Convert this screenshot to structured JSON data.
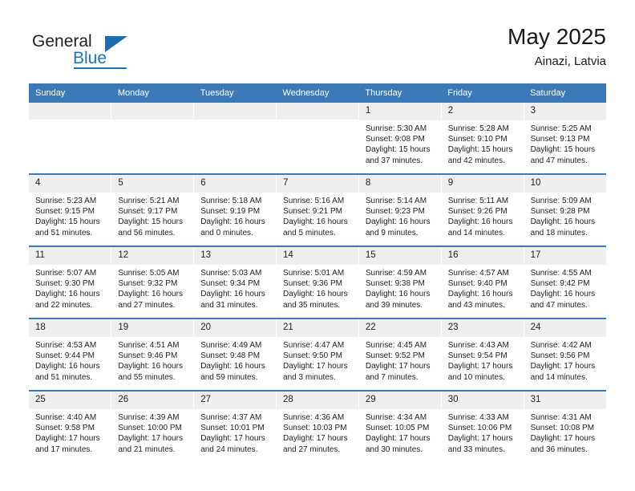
{
  "brand": {
    "name_top": "General",
    "name_bottom": "Blue",
    "triangle_icon": "triangle-icon",
    "color_blue": "#1c75bc",
    "color_dark": "#231f20"
  },
  "header": {
    "title": "May 2025",
    "subtitle": "Ainazi, Latvia"
  },
  "calendar": {
    "accent_color": "#3b79b8",
    "daynum_background": "#efefef",
    "weekday_headers": [
      "Sunday",
      "Monday",
      "Tuesday",
      "Wednesday",
      "Thursday",
      "Friday",
      "Saturday"
    ],
    "weeks": [
      [
        {
          "day": "",
          "sunrise": "",
          "sunset": "",
          "daylight_line1": "",
          "daylight_line2": ""
        },
        {
          "day": "",
          "sunrise": "",
          "sunset": "",
          "daylight_line1": "",
          "daylight_line2": ""
        },
        {
          "day": "",
          "sunrise": "",
          "sunset": "",
          "daylight_line1": "",
          "daylight_line2": ""
        },
        {
          "day": "",
          "sunrise": "",
          "sunset": "",
          "daylight_line1": "",
          "daylight_line2": ""
        },
        {
          "day": "1",
          "sunrise": "Sunrise: 5:30 AM",
          "sunset": "Sunset: 9:08 PM",
          "daylight_line1": "Daylight: 15 hours",
          "daylight_line2": "and 37 minutes."
        },
        {
          "day": "2",
          "sunrise": "Sunrise: 5:28 AM",
          "sunset": "Sunset: 9:10 PM",
          "daylight_line1": "Daylight: 15 hours",
          "daylight_line2": "and 42 minutes."
        },
        {
          "day": "3",
          "sunrise": "Sunrise: 5:25 AM",
          "sunset": "Sunset: 9:13 PM",
          "daylight_line1": "Daylight: 15 hours",
          "daylight_line2": "and 47 minutes."
        }
      ],
      [
        {
          "day": "4",
          "sunrise": "Sunrise: 5:23 AM",
          "sunset": "Sunset: 9:15 PM",
          "daylight_line1": "Daylight: 15 hours",
          "daylight_line2": "and 51 minutes."
        },
        {
          "day": "5",
          "sunrise": "Sunrise: 5:21 AM",
          "sunset": "Sunset: 9:17 PM",
          "daylight_line1": "Daylight: 15 hours",
          "daylight_line2": "and 56 minutes."
        },
        {
          "day": "6",
          "sunrise": "Sunrise: 5:18 AM",
          "sunset": "Sunset: 9:19 PM",
          "daylight_line1": "Daylight: 16 hours",
          "daylight_line2": "and 0 minutes."
        },
        {
          "day": "7",
          "sunrise": "Sunrise: 5:16 AM",
          "sunset": "Sunset: 9:21 PM",
          "daylight_line1": "Daylight: 16 hours",
          "daylight_line2": "and 5 minutes."
        },
        {
          "day": "8",
          "sunrise": "Sunrise: 5:14 AM",
          "sunset": "Sunset: 9:23 PM",
          "daylight_line1": "Daylight: 16 hours",
          "daylight_line2": "and 9 minutes."
        },
        {
          "day": "9",
          "sunrise": "Sunrise: 5:11 AM",
          "sunset": "Sunset: 9:26 PM",
          "daylight_line1": "Daylight: 16 hours",
          "daylight_line2": "and 14 minutes."
        },
        {
          "day": "10",
          "sunrise": "Sunrise: 5:09 AM",
          "sunset": "Sunset: 9:28 PM",
          "daylight_line1": "Daylight: 16 hours",
          "daylight_line2": "and 18 minutes."
        }
      ],
      [
        {
          "day": "11",
          "sunrise": "Sunrise: 5:07 AM",
          "sunset": "Sunset: 9:30 PM",
          "daylight_line1": "Daylight: 16 hours",
          "daylight_line2": "and 22 minutes."
        },
        {
          "day": "12",
          "sunrise": "Sunrise: 5:05 AM",
          "sunset": "Sunset: 9:32 PM",
          "daylight_line1": "Daylight: 16 hours",
          "daylight_line2": "and 27 minutes."
        },
        {
          "day": "13",
          "sunrise": "Sunrise: 5:03 AM",
          "sunset": "Sunset: 9:34 PM",
          "daylight_line1": "Daylight: 16 hours",
          "daylight_line2": "and 31 minutes."
        },
        {
          "day": "14",
          "sunrise": "Sunrise: 5:01 AM",
          "sunset": "Sunset: 9:36 PM",
          "daylight_line1": "Daylight: 16 hours",
          "daylight_line2": "and 35 minutes."
        },
        {
          "day": "15",
          "sunrise": "Sunrise: 4:59 AM",
          "sunset": "Sunset: 9:38 PM",
          "daylight_line1": "Daylight: 16 hours",
          "daylight_line2": "and 39 minutes."
        },
        {
          "day": "16",
          "sunrise": "Sunrise: 4:57 AM",
          "sunset": "Sunset: 9:40 PM",
          "daylight_line1": "Daylight: 16 hours",
          "daylight_line2": "and 43 minutes."
        },
        {
          "day": "17",
          "sunrise": "Sunrise: 4:55 AM",
          "sunset": "Sunset: 9:42 PM",
          "daylight_line1": "Daylight: 16 hours",
          "daylight_line2": "and 47 minutes."
        }
      ],
      [
        {
          "day": "18",
          "sunrise": "Sunrise: 4:53 AM",
          "sunset": "Sunset: 9:44 PM",
          "daylight_line1": "Daylight: 16 hours",
          "daylight_line2": "and 51 minutes."
        },
        {
          "day": "19",
          "sunrise": "Sunrise: 4:51 AM",
          "sunset": "Sunset: 9:46 PM",
          "daylight_line1": "Daylight: 16 hours",
          "daylight_line2": "and 55 minutes."
        },
        {
          "day": "20",
          "sunrise": "Sunrise: 4:49 AM",
          "sunset": "Sunset: 9:48 PM",
          "daylight_line1": "Daylight: 16 hours",
          "daylight_line2": "and 59 minutes."
        },
        {
          "day": "21",
          "sunrise": "Sunrise: 4:47 AM",
          "sunset": "Sunset: 9:50 PM",
          "daylight_line1": "Daylight: 17 hours",
          "daylight_line2": "and 3 minutes."
        },
        {
          "day": "22",
          "sunrise": "Sunrise: 4:45 AM",
          "sunset": "Sunset: 9:52 PM",
          "daylight_line1": "Daylight: 17 hours",
          "daylight_line2": "and 7 minutes."
        },
        {
          "day": "23",
          "sunrise": "Sunrise: 4:43 AM",
          "sunset": "Sunset: 9:54 PM",
          "daylight_line1": "Daylight: 17 hours",
          "daylight_line2": "and 10 minutes."
        },
        {
          "day": "24",
          "sunrise": "Sunrise: 4:42 AM",
          "sunset": "Sunset: 9:56 PM",
          "daylight_line1": "Daylight: 17 hours",
          "daylight_line2": "and 14 minutes."
        }
      ],
      [
        {
          "day": "25",
          "sunrise": "Sunrise: 4:40 AM",
          "sunset": "Sunset: 9:58 PM",
          "daylight_line1": "Daylight: 17 hours",
          "daylight_line2": "and 17 minutes."
        },
        {
          "day": "26",
          "sunrise": "Sunrise: 4:39 AM",
          "sunset": "Sunset: 10:00 PM",
          "daylight_line1": "Daylight: 17 hours",
          "daylight_line2": "and 21 minutes."
        },
        {
          "day": "27",
          "sunrise": "Sunrise: 4:37 AM",
          "sunset": "Sunset: 10:01 PM",
          "daylight_line1": "Daylight: 17 hours",
          "daylight_line2": "and 24 minutes."
        },
        {
          "day": "28",
          "sunrise": "Sunrise: 4:36 AM",
          "sunset": "Sunset: 10:03 PM",
          "daylight_line1": "Daylight: 17 hours",
          "daylight_line2": "and 27 minutes."
        },
        {
          "day": "29",
          "sunrise": "Sunrise: 4:34 AM",
          "sunset": "Sunset: 10:05 PM",
          "daylight_line1": "Daylight: 17 hours",
          "daylight_line2": "and 30 minutes."
        },
        {
          "day": "30",
          "sunrise": "Sunrise: 4:33 AM",
          "sunset": "Sunset: 10:06 PM",
          "daylight_line1": "Daylight: 17 hours",
          "daylight_line2": "and 33 minutes."
        },
        {
          "day": "31",
          "sunrise": "Sunrise: 4:31 AM",
          "sunset": "Sunset: 10:08 PM",
          "daylight_line1": "Daylight: 17 hours",
          "daylight_line2": "and 36 minutes."
        }
      ]
    ]
  }
}
